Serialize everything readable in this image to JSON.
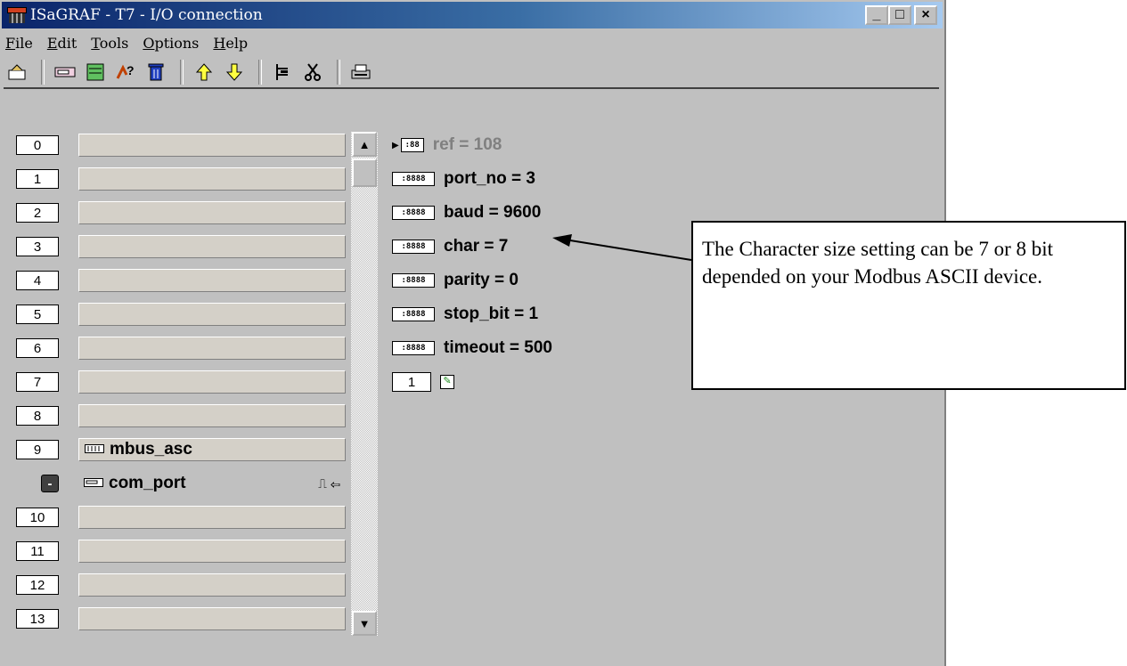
{
  "window": {
    "title": "ISaGRAF - T7 - I/O connection",
    "controls": {
      "minimize": "_",
      "maximize": "□",
      "close": "×"
    }
  },
  "menu": {
    "items": [
      {
        "label": "File",
        "underline": "F",
        "rest": "ile"
      },
      {
        "label": "Edit",
        "underline": "E",
        "rest": "dit"
      },
      {
        "label": "Tools",
        "underline": "T",
        "rest": "ools"
      },
      {
        "label": "Options",
        "underline": "O",
        "rest": "ptions"
      },
      {
        "label": "Help",
        "underline": "H",
        "rest": "elp"
      }
    ]
  },
  "toolbar": {
    "icons": [
      "open-board-icon",
      "connect-board-icon",
      "board-properties-icon",
      "help-icon",
      "delete-icon",
      "move-up-icon",
      "move-down-icon",
      "tree-icon",
      "cut-icon",
      "print-icon"
    ]
  },
  "slots": {
    "rows": [
      {
        "num": "0",
        "label": ""
      },
      {
        "num": "1",
        "label": ""
      },
      {
        "num": "2",
        "label": ""
      },
      {
        "num": "3",
        "label": ""
      },
      {
        "num": "4",
        "label": ""
      },
      {
        "num": "5",
        "label": ""
      },
      {
        "num": "6",
        "label": ""
      },
      {
        "num": "7",
        "label": ""
      },
      {
        "num": "8",
        "label": ""
      },
      {
        "num": "9",
        "label": "mbus_asc"
      },
      {
        "num": "-",
        "label": "com_port"
      },
      {
        "num": "10",
        "label": ""
      },
      {
        "num": "11",
        "label": ""
      },
      {
        "num": "12",
        "label": ""
      },
      {
        "num": "13",
        "label": ""
      }
    ]
  },
  "params": {
    "items": [
      {
        "text": "ref = 108",
        "icon": ":88"
      },
      {
        "text": "port_no = 3",
        "icon": ":8888"
      },
      {
        "text": "baud = 9600",
        "icon": ":8888"
      },
      {
        "text": "char = 7",
        "icon": ":8888"
      },
      {
        "text": "parity = 0",
        "icon": ":8888"
      },
      {
        "text": "stop_bit = 1",
        "icon": ":8888"
      },
      {
        "text": "timeout = 500",
        "icon": ":8888"
      }
    ],
    "channel": "1"
  },
  "callout": {
    "text": "The Character size setting can be 7 or 8 bit depended on your Modbus ASCII device."
  }
}
